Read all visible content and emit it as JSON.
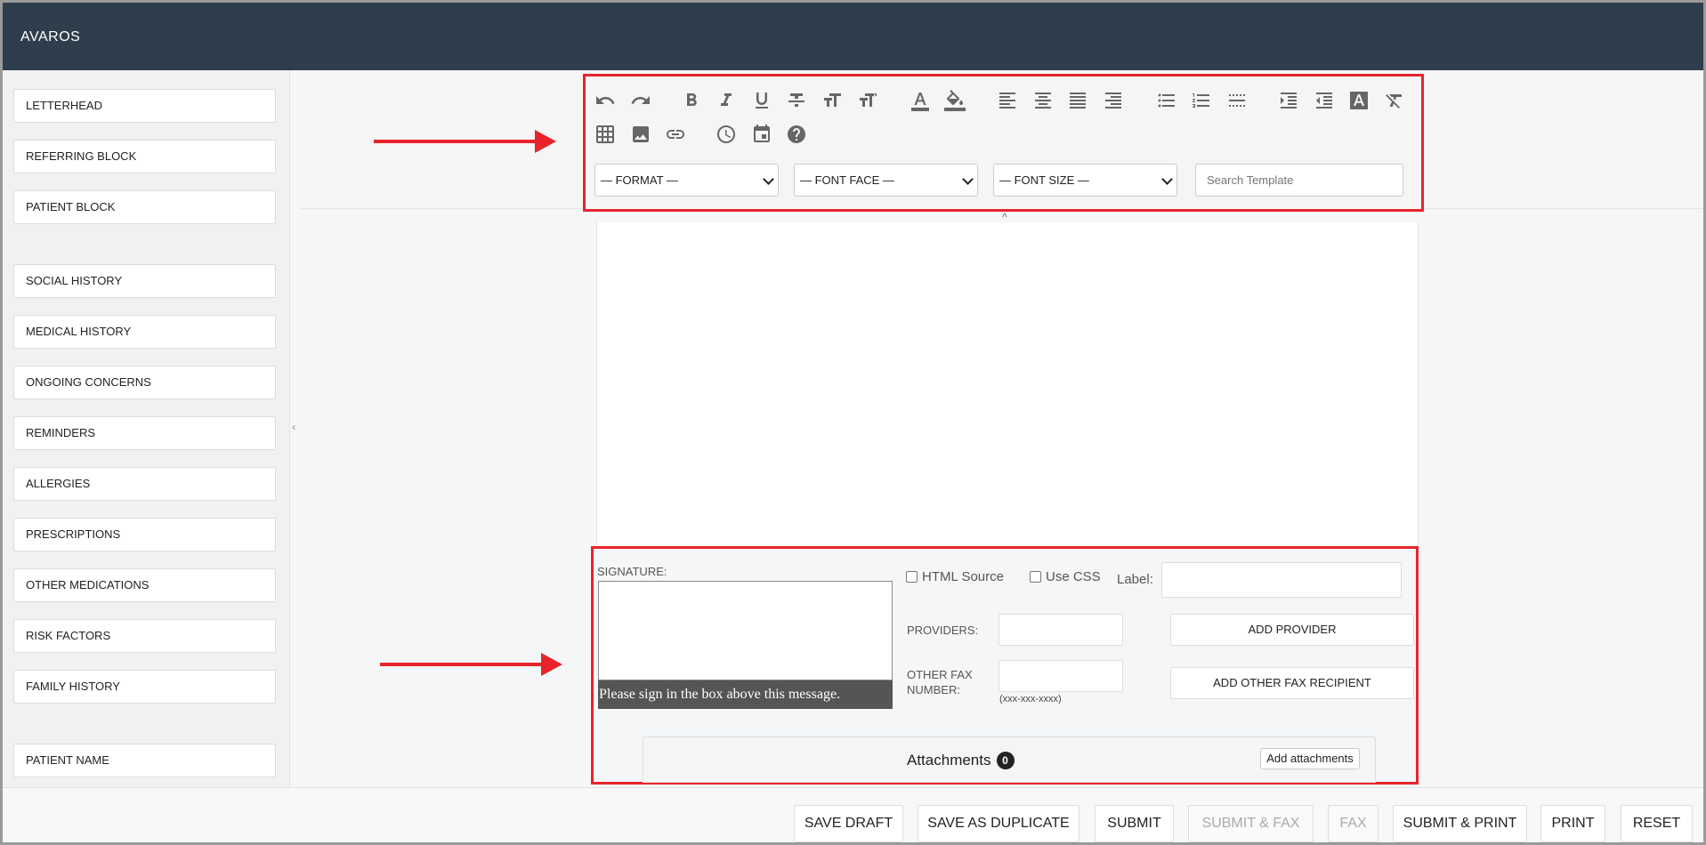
{
  "app": {
    "brand": "AVAROS"
  },
  "sidebar": {
    "items": [
      "LETTERHEAD",
      "REFERRING BLOCK",
      "PATIENT BLOCK",
      "SOCIAL HISTORY",
      "MEDICAL HISTORY",
      "ONGOING CONCERNS",
      "REMINDERS",
      "ALLERGIES",
      "PRESCRIPTIONS",
      "OTHER MEDICATIONS",
      "RISK FACTORS",
      "FAMILY HISTORY",
      "PATIENT NAME"
    ]
  },
  "toolbar": {
    "icons": [
      "undo-icon",
      "redo-icon",
      "bold-icon",
      "italic-icon",
      "underline-icon",
      "strikethrough-icon",
      "text-size-icon",
      "text-height-icon",
      "font-color-icon",
      "fill-color-icon",
      "align-left-icon",
      "align-center-icon",
      "align-justify-icon",
      "align-right-icon",
      "bullet-list-icon",
      "numbered-list-icon",
      "horizontal-rule-icon",
      "indent-icon",
      "outdent-icon",
      "text-background-icon",
      "clear-format-icon",
      "table-icon",
      "image-icon",
      "link-icon",
      "clock-icon",
      "calendar-icon",
      "help-icon"
    ],
    "format_select": "— FORMAT —",
    "font_face_select": "— FONT FACE —",
    "font_size_select": "— FONT SIZE —",
    "search_placeholder": "Search Template"
  },
  "signature": {
    "label": "SIGNATURE:",
    "message": "Please sign in the box above this message."
  },
  "options": {
    "html_source": "HTML Source",
    "use_css": "Use CSS",
    "label": "Label:"
  },
  "providers": {
    "label": "PROVIDERS:",
    "add_button": "ADD PROVIDER"
  },
  "fax": {
    "label_line1": "OTHER FAX",
    "label_line2": "NUMBER:",
    "hint": "(xxx-xxx-xxxx)",
    "add_button": "ADD OTHER FAX RECIPIENT"
  },
  "attachments": {
    "title": "Attachments",
    "count": "0",
    "add_button": "Add attachments"
  },
  "footer": {
    "save_draft": "SAVE DRAFT",
    "save_as_duplicate": "SAVE AS DUPLICATE",
    "submit": "SUBMIT",
    "submit_fax": "SUBMIT & FAX",
    "fax": "FAX",
    "submit_print": "SUBMIT & PRINT",
    "print": "PRINT",
    "reset": "RESET"
  }
}
